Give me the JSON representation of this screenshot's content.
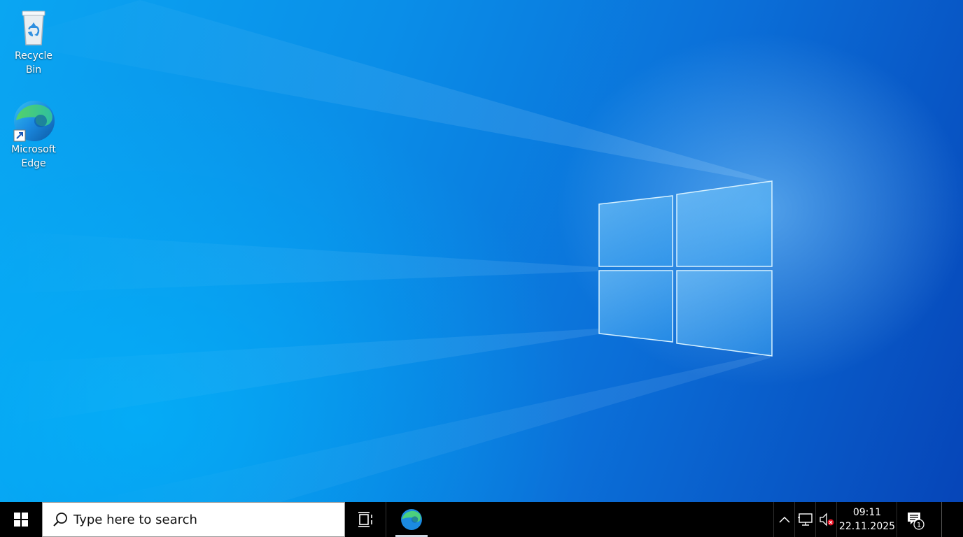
{
  "desktop": {
    "icons": [
      {
        "label": "Recycle Bin",
        "icon": "recycle-bin-icon"
      },
      {
        "label": "Microsoft\nEdge",
        "label_line1": "Microsoft",
        "label_line2": "Edge",
        "icon": "edge-icon"
      }
    ],
    "wallpaper": "windows-10-hero",
    "colors": {
      "accent": "#0a8ee8",
      "dark": "#0645b8"
    }
  },
  "taskbar": {
    "start_icon": "windows-logo-icon",
    "search_placeholder": "Type here to search",
    "task_view_icon": "task-view-icon",
    "pinned": [
      {
        "name": "Microsoft Edge",
        "icon": "edge-icon",
        "active": true
      }
    ],
    "tray": {
      "chevron_icon": "chevron-up-icon",
      "network_icon": "network-icon",
      "volume_icon": "volume-muted-icon",
      "time": "09:11",
      "date": "22.11.2025",
      "notifications_icon": "notification-icon",
      "notifications_count": "1"
    }
  }
}
